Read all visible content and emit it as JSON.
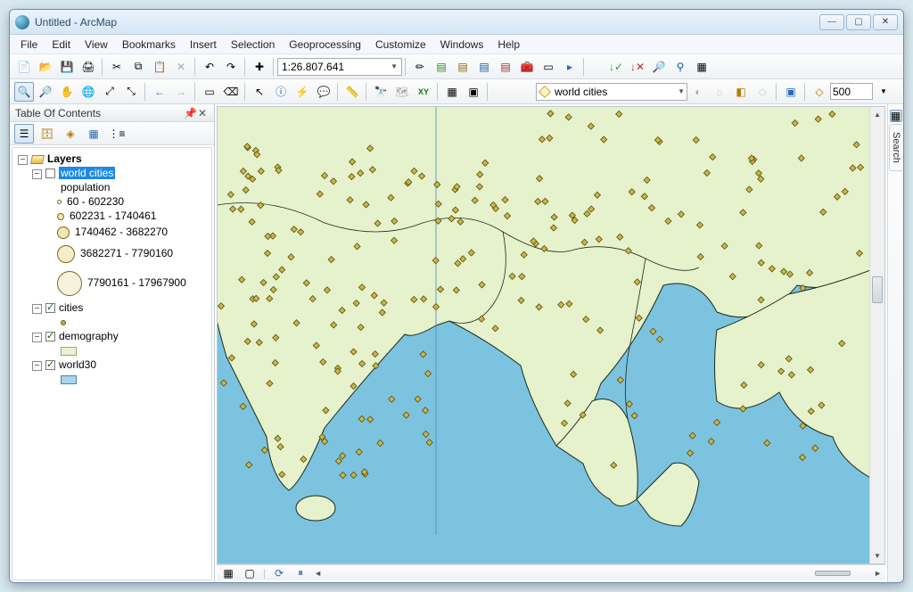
{
  "window": {
    "title": "Untitled - ArcMap"
  },
  "menu": [
    "File",
    "Edit",
    "View",
    "Bookmarks",
    "Insert",
    "Selection",
    "Geoprocessing",
    "Customize",
    "Windows",
    "Help"
  ],
  "toolbar1": {
    "scale": "1:26.807.641"
  },
  "toolbar2": {
    "layer": "world cities",
    "buffer": "500"
  },
  "toc": {
    "title": "Table Of Contents",
    "root": "Layers",
    "worldcities": {
      "name": "world cities",
      "field": "population",
      "classes": [
        {
          "sym": "d0",
          "label": "60 - 602230"
        },
        {
          "sym": "d1",
          "label": "602231 - 1740461"
        },
        {
          "sym": "d2",
          "label": "1740462 - 3682270"
        },
        {
          "sym": "d3",
          "label": "3682271 - 7790160"
        },
        {
          "sym": "d4",
          "label": "7790161 - 17967900"
        }
      ]
    },
    "cities": "cities",
    "demography": "demography",
    "world30": "world30"
  },
  "search": "Search",
  "chart_data": {
    "type": "map",
    "title": "world cities by population",
    "region": "South Asia / Southeast Asia",
    "layers": [
      {
        "name": "world30",
        "type": "polygon",
        "fill": "#a8d4ec"
      },
      {
        "name": "demography",
        "type": "polygon",
        "fill": "#e6f2cc"
      },
      {
        "name": "cities",
        "type": "point",
        "symbol": "diamond",
        "fill": "#c8b84a"
      },
      {
        "name": "world cities",
        "type": "graduated_point",
        "field": "population",
        "breaks": [
          60,
          602230,
          1740461,
          3682270,
          7790160,
          17967900
        ]
      }
    ],
    "approx_scale": 26807641
  }
}
